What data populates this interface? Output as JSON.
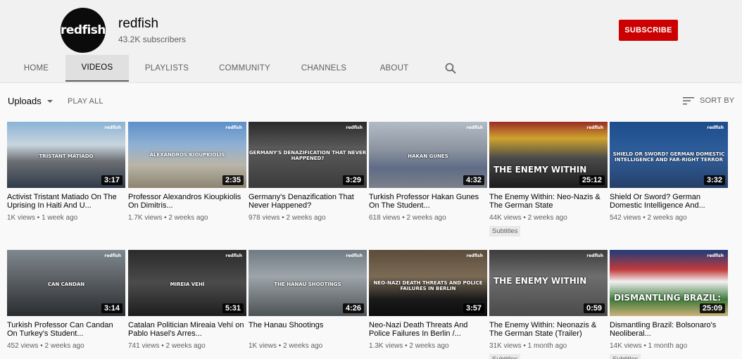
{
  "channel": {
    "name": "redfish",
    "subscribers": "43.2K subscribers",
    "avatar_text": "redfish",
    "subscribe_label": "SUBSCRIBE"
  },
  "tabs": [
    {
      "label": "HOME",
      "active": false
    },
    {
      "label": "VIDEOS",
      "active": true
    },
    {
      "label": "PLAYLISTS",
      "active": false
    },
    {
      "label": "COMMUNITY",
      "active": false
    },
    {
      "label": "CHANNELS",
      "active": false
    },
    {
      "label": "ABOUT",
      "active": false
    }
  ],
  "toolbar": {
    "uploads_label": "Uploads",
    "play_all_label": "PLAY ALL",
    "sort_label": "SORT BY"
  },
  "colors": {
    "subscribe": "#cc0000",
    "background": "#f9f9f9"
  },
  "videos": [
    {
      "title": "Activist Tristant Matiado On The Uprising In Haiti And U...",
      "views": "1K views",
      "age": "1 week ago",
      "duration": "3:17",
      "thumb_text": "TRISTANT MATIADO",
      "badge": ""
    },
    {
      "title": "Professor Alexandros Kioupkiolis On Dimitris...",
      "views": "1.7K views",
      "age": "2 weeks ago",
      "duration": "2:35",
      "thumb_text": "ALEXANDROS KIOUPKIOLIS",
      "badge": ""
    },
    {
      "title": "Germany's Denazification That Never Happened?",
      "views": "978 views",
      "age": "2 weeks ago",
      "duration": "3:29",
      "thumb_text": "GERMANY'S DENAZIFICATION THAT NEVER HAPPENED?",
      "badge": ""
    },
    {
      "title": "Turkish Professor Hakan Gunes On The Student...",
      "views": "618 views",
      "age": "2 weeks ago",
      "duration": "4:32",
      "thumb_text": "HAKAN GUNES",
      "badge": ""
    },
    {
      "title": "The Enemy Within: Neo-Nazis & The German State",
      "views": "44K views",
      "age": "2 weeks ago",
      "duration": "25:12",
      "thumb_text": "THE ENEMY WITHIN",
      "badge": "Subtitles"
    },
    {
      "title": "Shield Or Sword? German Domestic Intelligence And...",
      "views": "542 views",
      "age": "2 weeks ago",
      "duration": "3:32",
      "thumb_text": "SHIELD OR SWORD? GERMAN DOMESTIC INTELLIGENCE AND FAR-RIGHT TERROR",
      "badge": ""
    },
    {
      "title": "Turkish Professor Can Candan On Turkey's Student...",
      "views": "452 views",
      "age": "2 weeks ago",
      "duration": "3:14",
      "thumb_text": "CAN CANDAN",
      "badge": ""
    },
    {
      "title": "Catalan Politician Mireaia Vehí on Pablo Hasel's Arres...",
      "views": "741 views",
      "age": "2 weeks ago",
      "duration": "5:31",
      "thumb_text": "MIREIA VEHÍ",
      "badge": ""
    },
    {
      "title": "The Hanau Shootings",
      "views": "1K views",
      "age": "2 weeks ago",
      "duration": "4:26",
      "thumb_text": "THE HANAU SHOOTINGS",
      "badge": ""
    },
    {
      "title": "Neo-Nazi Death Threats And Police Failures In Berlin /...",
      "views": "1.3K views",
      "age": "2 weeks ago",
      "duration": "3:57",
      "thumb_text": "NEO-NAZI DEATH THREATS AND POLICE FAILURES IN BERLIN",
      "badge": ""
    },
    {
      "title": "The Enemy Within: Neonazis & The German State (Trailer)",
      "views": "31K views",
      "age": "1 month ago",
      "duration": "0:59",
      "thumb_text": "THE ENEMY WITHIN",
      "badge": "Subtitles"
    },
    {
      "title": "Dismantling Brazil: Bolsonaro's Neoliberal...",
      "views": "14K views",
      "age": "1 month ago",
      "duration": "25:09",
      "thumb_text": "DISMANTLING BRAZIL:",
      "badge": "Subtitles"
    }
  ]
}
